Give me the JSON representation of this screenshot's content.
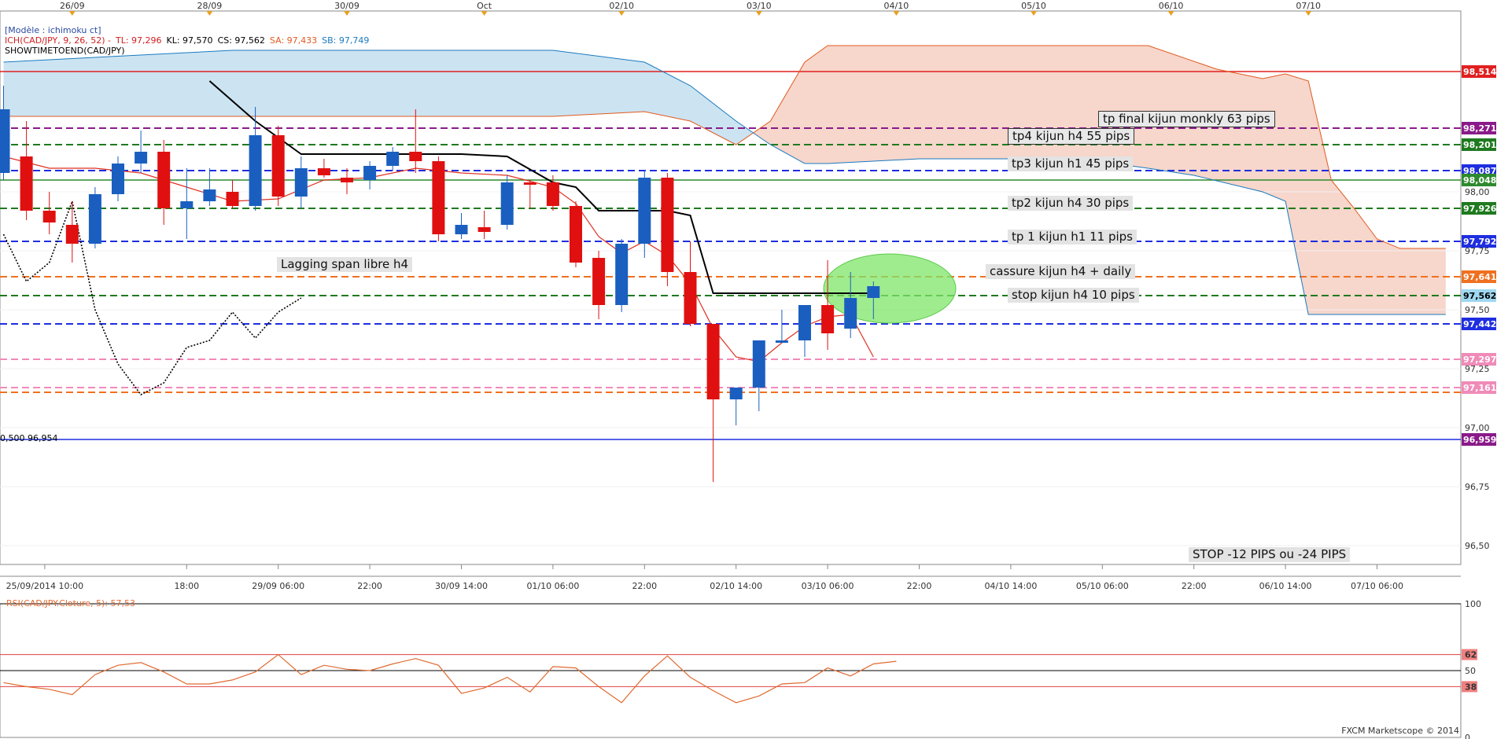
{
  "legend": {
    "model": "[Modèle : ichimoku ct]",
    "ich": "ICH(CAD/JPY, 9, 26, 52) -",
    "tl": "TL: 97,296",
    "kl": "KL: 97,570",
    "cs": "CS: 97,562",
    "sa": "SA: 97,433",
    "sb": "SB: 97,749",
    "showtime": "SHOWTIMETOEND(CAD/JPY)"
  },
  "annotations": {
    "tp_final": "tp final kijun monkly 63 pips",
    "tp4": "tp4 kijun h4 55 pips",
    "tp3": "tp3 kijun h1 45 pips",
    "tp2": "tp2 kijun h4 30 pips",
    "tp1": "tp 1 kijun h1 11 pips",
    "cassure": "cassure kijun h4 + daily",
    "stop": "stop kijun h4 10 pips",
    "lagging": "Lagging span libre h4",
    "stop_pips": "STOP -12 PIPS ou -24 PIPS",
    "fibo": "0,500 96,954"
  },
  "rsi_legend": "RSI(CAD/JPY.Cloture, 5): 57,53",
  "copyright": "FXCM Marketscope © 2014",
  "colors": {
    "bull": "#1a5fc0",
    "bear": "#e01010",
    "cloud_bull": "#cce4f2",
    "cloud_bear": "#f7d6cb",
    "tenkan": "#e03020",
    "kijun": "#000000",
    "rsi": "#e06a30",
    "target_zone": "#7fe56a"
  },
  "chart_data": {
    "type": "candlestick",
    "symbol": "CAD/JPY",
    "ylim": [
      96.42,
      98.72
    ],
    "y_ticks": [
      {
        "v": 98.0,
        "label": "98,00"
      },
      {
        "v": 97.75,
        "label": "97,75"
      },
      {
        "v": 97.5,
        "label": "97,50"
      },
      {
        "v": 97.25,
        "label": "97,25"
      },
      {
        "v": 97.0,
        "label": "97,00"
      },
      {
        "v": 96.75,
        "label": "96,75"
      },
      {
        "v": 96.5,
        "label": "96,50"
      }
    ],
    "top_date_labels": [
      {
        "i": 3,
        "label": "26/09"
      },
      {
        "i": 9,
        "label": "28/09"
      },
      {
        "i": 15,
        "label": "30/09"
      },
      {
        "i": 21,
        "label": "Oct"
      },
      {
        "i": 27,
        "label": "02/10"
      },
      {
        "i": 33,
        "label": "03/10"
      },
      {
        "i": 39,
        "label": "04/10"
      },
      {
        "i": 45,
        "label": "05/10"
      },
      {
        "i": 51,
        "label": "06/10"
      },
      {
        "i": 57,
        "label": "07/10"
      }
    ],
    "bottom_time_labels": [
      {
        "i": 1.8,
        "label": "25/09/2014 10:00"
      },
      {
        "i": 8,
        "label": "18:00"
      },
      {
        "i": 12,
        "label": "29/09 06:00"
      },
      {
        "i": 16,
        "label": "22:00"
      },
      {
        "i": 20,
        "label": "30/09 14:00"
      },
      {
        "i": 24,
        "label": "01/10 06:00"
      },
      {
        "i": 28,
        "label": "22:00"
      },
      {
        "i": 32,
        "label": "02/10 14:00"
      },
      {
        "i": 36,
        "label": "03/10 06:00"
      },
      {
        "i": 40,
        "label": "22:00"
      },
      {
        "i": 44,
        "label": "04/10 14:00"
      },
      {
        "i": 48,
        "label": "05/10 06:00"
      },
      {
        "i": 52,
        "label": "22:00"
      },
      {
        "i": 56,
        "label": "06/10 14:00"
      },
      {
        "i": 60,
        "label": "07/10 06:00"
      }
    ],
    "candles": [
      {
        "o": 98.08,
        "h": 98.45,
        "l": 98.05,
        "c": 98.35
      },
      {
        "o": 98.15,
        "h": 98.3,
        "l": 97.88,
        "c": 97.92
      },
      {
        "o": 97.92,
        "h": 98.0,
        "l": 97.82,
        "c": 97.87
      },
      {
        "o": 97.86,
        "h": 97.96,
        "l": 97.7,
        "c": 97.78
      },
      {
        "o": 97.78,
        "h": 98.02,
        "l": 97.76,
        "c": 97.99
      },
      {
        "o": 97.99,
        "h": 98.15,
        "l": 97.96,
        "c": 98.12
      },
      {
        "o": 98.12,
        "h": 98.26,
        "l": 98.08,
        "c": 98.17
      },
      {
        "o": 98.17,
        "h": 98.22,
        "l": 97.86,
        "c": 97.93
      },
      {
        "o": 97.93,
        "h": 98.1,
        "l": 97.8,
        "c": 97.96
      },
      {
        "o": 97.96,
        "h": 98.1,
        "l": 97.94,
        "c": 98.01
      },
      {
        "o": 98.0,
        "h": 98.05,
        "l": 97.93,
        "c": 97.94
      },
      {
        "o": 97.94,
        "h": 98.36,
        "l": 97.92,
        "c": 98.24
      },
      {
        "o": 98.24,
        "h": 98.28,
        "l": 97.94,
        "c": 97.98
      },
      {
        "o": 97.98,
        "h": 98.15,
        "l": 97.93,
        "c": 98.1
      },
      {
        "o": 98.1,
        "h": 98.14,
        "l": 98.06,
        "c": 98.07
      },
      {
        "o": 98.06,
        "h": 98.1,
        "l": 97.99,
        "c": 98.04
      },
      {
        "o": 98.05,
        "h": 98.13,
        "l": 98.01,
        "c": 98.11
      },
      {
        "o": 98.11,
        "h": 98.19,
        "l": 98.09,
        "c": 98.17
      },
      {
        "o": 98.17,
        "h": 98.35,
        "l": 98.08,
        "c": 98.13
      },
      {
        "o": 98.13,
        "h": 98.15,
        "l": 97.79,
        "c": 97.82
      },
      {
        "o": 97.82,
        "h": 97.91,
        "l": 97.8,
        "c": 97.86
      },
      {
        "o": 97.85,
        "h": 97.92,
        "l": 97.8,
        "c": 97.83
      },
      {
        "o": 97.86,
        "h": 98.07,
        "l": 97.84,
        "c": 98.04
      },
      {
        "o": 98.04,
        "h": 98.05,
        "l": 97.93,
        "c": 98.03
      },
      {
        "o": 98.04,
        "h": 98.07,
        "l": 97.92,
        "c": 97.94
      },
      {
        "o": 97.94,
        "h": 97.96,
        "l": 97.68,
        "c": 97.7
      },
      {
        "o": 97.72,
        "h": 97.75,
        "l": 97.46,
        "c": 97.52
      },
      {
        "o": 97.52,
        "h": 97.8,
        "l": 97.49,
        "c": 97.78
      },
      {
        "o": 97.78,
        "h": 98.09,
        "l": 97.72,
        "c": 98.06
      },
      {
        "o": 98.06,
        "h": 98.08,
        "l": 97.6,
        "c": 97.66
      },
      {
        "o": 97.66,
        "h": 97.79,
        "l": 97.43,
        "c": 97.44
      },
      {
        "o": 97.44,
        "h": 97.44,
        "l": 96.77,
        "c": 97.12
      },
      {
        "o": 97.12,
        "h": 97.17,
        "l": 97.01,
        "c": 97.17
      },
      {
        "o": 97.17,
        "h": 97.37,
        "l": 97.07,
        "c": 97.37
      },
      {
        "o": 97.36,
        "h": 97.5,
        "l": 97.36,
        "c": 97.37
      },
      {
        "o": 97.37,
        "h": 97.52,
        "l": 97.3,
        "c": 97.52
      },
      {
        "o": 97.52,
        "h": 97.71,
        "l": 97.33,
        "c": 97.4
      },
      {
        "o": 97.42,
        "h": 97.66,
        "l": 97.38,
        "c": 97.55
      },
      {
        "o": 97.55,
        "h": 97.62,
        "l": 97.46,
        "c": 97.6
      }
    ],
    "tenkan": [
      [
        0,
        98.15
      ],
      [
        2,
        98.1
      ],
      [
        4,
        98.1
      ],
      [
        6,
        98.08
      ],
      [
        8,
        98.02
      ],
      [
        10,
        97.96
      ],
      [
        12,
        97.97
      ],
      [
        14,
        98.05
      ],
      [
        16,
        98.06
      ],
      [
        18,
        98.1
      ],
      [
        20,
        98.08
      ],
      [
        22,
        98.07
      ],
      [
        24,
        98.02
      ],
      [
        25,
        97.95
      ],
      [
        26,
        97.81
      ],
      [
        27,
        97.74
      ],
      [
        28,
        97.79
      ],
      [
        29,
        97.73
      ],
      [
        30,
        97.61
      ],
      [
        31,
        97.42
      ],
      [
        32,
        97.3
      ],
      [
        33,
        97.28
      ],
      [
        34,
        97.36
      ],
      [
        35,
        97.43
      ],
      [
        36,
        97.47
      ],
      [
        37,
        97.48
      ],
      [
        38,
        97.3
      ]
    ],
    "kijun": [
      [
        9,
        98.47
      ],
      [
        11,
        98.3
      ],
      [
        13,
        98.16
      ],
      [
        15,
        98.16
      ],
      [
        17,
        98.16
      ],
      [
        20,
        98.16
      ],
      [
        22,
        98.15
      ],
      [
        24,
        98.04
      ],
      [
        25,
        98.02
      ],
      [
        26,
        97.92
      ],
      [
        28,
        97.92
      ],
      [
        29,
        97.92
      ],
      [
        30,
        97.9
      ],
      [
        31,
        97.57
      ],
      [
        32,
        97.57
      ],
      [
        34,
        97.57
      ],
      [
        36,
        97.57
      ],
      [
        38,
        97.57
      ]
    ],
    "senkou_a": [
      [
        0,
        98.32
      ],
      [
        10,
        98.32
      ],
      [
        20,
        98.32
      ],
      [
        24,
        98.32
      ],
      [
        28,
        98.34
      ],
      [
        30,
        98.3
      ],
      [
        32,
        98.2
      ],
      [
        33.5,
        98.3
      ],
      [
        35,
        98.55
      ],
      [
        36,
        98.62
      ],
      [
        40,
        98.62
      ],
      [
        50,
        98.62
      ],
      [
        53,
        98.52
      ],
      [
        55,
        98.48
      ],
      [
        56,
        98.5
      ],
      [
        57,
        98.47
      ],
      [
        58,
        98.05
      ],
      [
        59,
        97.93
      ],
      [
        60,
        97.8
      ],
      [
        61,
        97.76
      ],
      [
        63,
        97.76
      ]
    ],
    "senkou_b": [
      [
        0,
        98.55
      ],
      [
        10,
        98.6
      ],
      [
        20,
        98.6
      ],
      [
        24,
        98.6
      ],
      [
        28,
        98.55
      ],
      [
        30,
        98.45
      ],
      [
        32,
        98.3
      ],
      [
        33.5,
        98.2
      ],
      [
        35,
        98.12
      ],
      [
        36,
        98.12
      ],
      [
        40,
        98.14
      ],
      [
        47,
        98.14
      ],
      [
        50,
        98.1
      ],
      [
        52,
        98.07
      ],
      [
        55,
        98.0
      ],
      [
        56,
        97.96
      ],
      [
        57,
        97.48
      ],
      [
        60,
        97.48
      ],
      [
        63,
        97.48
      ]
    ],
    "chikou": [
      [
        0,
        97.82
      ],
      [
        1,
        97.62
      ],
      [
        2,
        97.7
      ],
      [
        3,
        97.96
      ],
      [
        4,
        97.5
      ],
      [
        5,
        97.27
      ],
      [
        6,
        97.14
      ],
      [
        7,
        97.19
      ],
      [
        8,
        97.34
      ],
      [
        9,
        97.37
      ],
      [
        10,
        97.49
      ],
      [
        11,
        97.38
      ],
      [
        12,
        97.49
      ],
      [
        13,
        97.55
      ]
    ],
    "levels": [
      {
        "v": 98.51,
        "label": "98,514",
        "color": "#e02020",
        "dash": false,
        "tag_bg": "#e02020",
        "tag_fg": "#ffffff"
      },
      {
        "v": 98.27,
        "label": "98,271",
        "color": "#8a1a8a",
        "dash": true,
        "tag_bg": "#8a1a8a",
        "tag_fg": "#ffffff"
      },
      {
        "v": 98.2,
        "label": "98,201",
        "color": "#1f7a1f",
        "dash": true,
        "tag_bg": "#1f7a1f",
        "tag_fg": "#ffffff"
      },
      {
        "v": 98.09,
        "label": "98,087",
        "color": "#1e2ee0",
        "dash": true,
        "tag_bg": "#1e2ee0",
        "tag_fg": "#ffffff"
      },
      {
        "v": 98.05,
        "label": "98,048",
        "color": "#2e8a2e",
        "dash": false,
        "tag_bg": "#2e8a2e",
        "tag_fg": "#ffffff"
      },
      {
        "v": 97.93,
        "label": "97,926",
        "color": "#1f7a1f",
        "dash": true,
        "tag_bg": "#1f7a1f",
        "tag_fg": "#ffffff"
      },
      {
        "v": 97.79,
        "label": "97,792",
        "color": "#1e2ee0",
        "dash": true,
        "tag_bg": "#1e2ee0",
        "tag_fg": "#ffffff"
      },
      {
        "v": 97.64,
        "label": "97,641",
        "color": "#f07020",
        "dash": true,
        "tag_bg": "#f07020",
        "tag_fg": "#ffffff"
      },
      {
        "v": 97.56,
        "label": "97,562",
        "color": "#1f7a1f",
        "dash": true,
        "tag_bg": "#9fd8f0",
        "tag_fg": "#000000"
      },
      {
        "v": 97.44,
        "label": "97,442",
        "color": "#1e2ee0",
        "dash": true,
        "tag_bg": "#1e2ee0",
        "tag_fg": "#ffffff"
      },
      {
        "v": 97.29,
        "label": "97,297",
        "color": "#f08bb8",
        "dash": true,
        "tag_bg": "#f08bb8",
        "tag_fg": "#ffffff"
      },
      {
        "v": 97.17,
        "label": "97,161",
        "color": "#f08bb8",
        "dash": true,
        "tag_bg": "#f08bb8",
        "tag_fg": "#ffffff"
      },
      {
        "v": 97.15,
        "label": "",
        "color": "#f07020",
        "dash": true,
        "tag_bg": "",
        "tag_fg": ""
      },
      {
        "v": 96.95,
        "label": "96,959",
        "color": "#1e2ee0",
        "dash": false,
        "tag_bg": "#8a1a8a",
        "tag_fg": "#ffffff"
      }
    ],
    "rsi": {
      "ylim": [
        0,
        100
      ],
      "ticks": [
        {
          "v": 100,
          "label": "100"
        },
        {
          "v": 62,
          "label": "62"
        },
        {
          "v": 50,
          "label": "50"
        },
        {
          "v": 38,
          "label": "38"
        },
        {
          "v": 0,
          "label": "0"
        }
      ],
      "values": [
        41,
        38,
        36,
        32,
        47,
        54,
        56,
        49,
        40,
        40,
        43,
        49,
        62,
        47,
        54,
        51,
        50,
        55,
        59,
        54,
        33,
        37,
        45,
        34,
        53,
        52,
        38,
        26,
        46,
        61,
        45,
        35,
        26,
        31,
        40,
        41,
        52,
        46,
        55,
        57
      ]
    }
  }
}
